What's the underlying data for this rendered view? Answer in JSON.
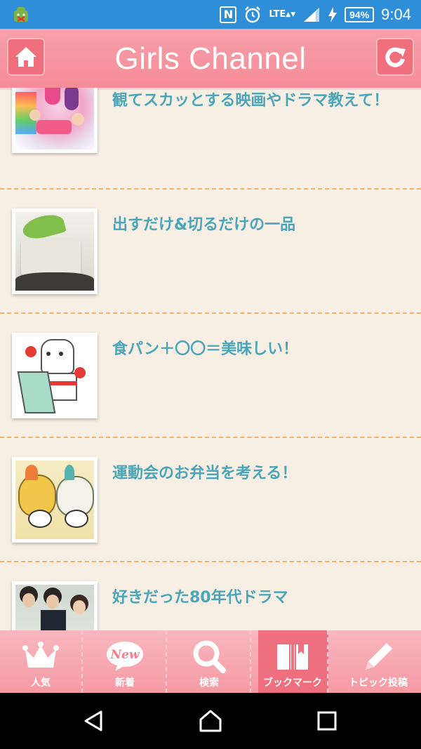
{
  "status": {
    "battery": "94%",
    "network": "LTE",
    "time": "9:04"
  },
  "header": {
    "title": "Girls Channel"
  },
  "topics": [
    {
      "title": "観てスカッとする映画やドラマ教えて！"
    },
    {
      "title": "出すだけ&切るだけの一品"
    },
    {
      "title": "食パン＋〇〇＝美味しい！"
    },
    {
      "title": "運動会のお弁当を考える！"
    },
    {
      "title": "好きだった80年代ドラマ"
    }
  ],
  "tabs": [
    {
      "label": "人気",
      "icon": "crown-icon"
    },
    {
      "label": "新着",
      "icon": "new-bubble-icon",
      "badge": "New"
    },
    {
      "label": "検索",
      "icon": "search-icon"
    },
    {
      "label": "ブックマーク",
      "icon": "bookmark-book-icon"
    },
    {
      "label": "トピック投稿",
      "icon": "pencil-icon"
    }
  ],
  "colors": {
    "status_bar": "#2e8fd8",
    "header": "#f58c97",
    "title_text": "#4aa5b8",
    "divider": "#f3b26a",
    "active_tab": "#ee6f7e"
  }
}
